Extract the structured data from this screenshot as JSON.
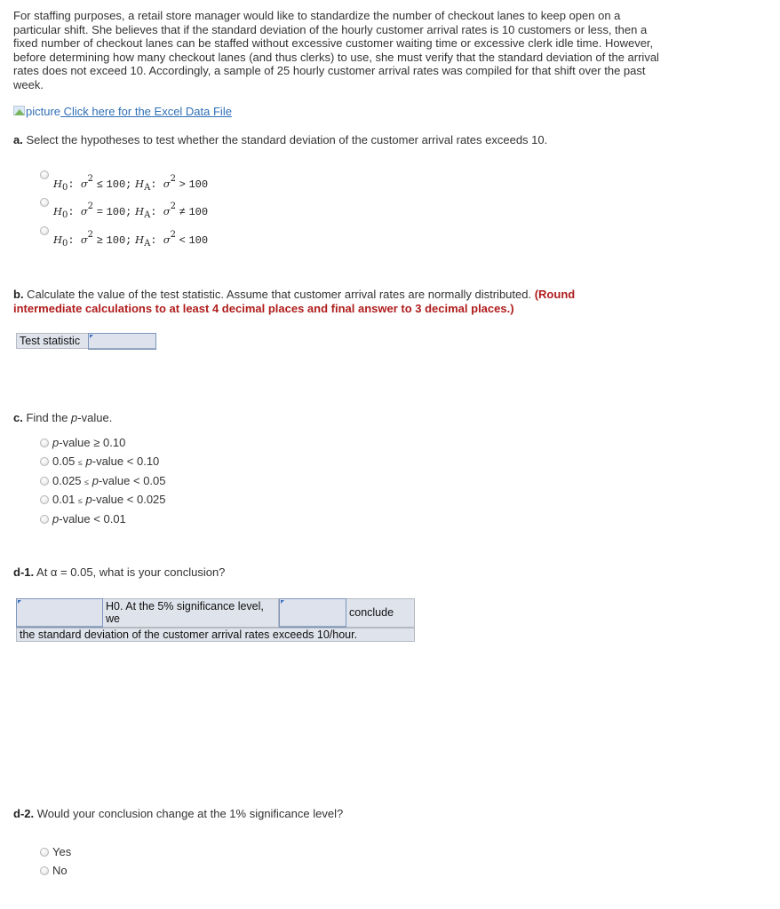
{
  "intro": "For staffing purposes, a retail store manager would like to standardize the number of checkout lanes to keep open on a particular shift. She believes that if the standard deviation of the hourly customer arrival rates is 10 customers or less, then a fixed number of checkout lanes can be staffed without excessive customer waiting time or excessive clerk idle time. However, before determining how many checkout lanes (and thus clerks) to use, she must verify that the standard deviation of the arrival rates does not exceed 10. Accordingly, a sample of 25 hourly customer arrival rates was compiled for that shift over the past week.",
  "data_link": {
    "icon": "broken-image-icon",
    "image_alt": "picture",
    "label": " Click here for the Excel Data File"
  },
  "part_a": {
    "label": "a.",
    "prompt": " Select the hypotheses to test whether the standard deviation of the customer arrival rates exceeds 10.",
    "options": [
      {
        "h0_rel": "≤",
        "h0_val": "100;",
        "ha_rel": ">",
        "ha_val": "100"
      },
      {
        "h0_rel": "=",
        "h0_val": "100;",
        "ha_rel": "≠",
        "ha_val": "100"
      },
      {
        "h0_rel": "≥",
        "h0_val": "100;",
        "ha_rel": "<",
        "ha_val": "100"
      }
    ],
    "h0_label": "H",
    "h0_sub": "0",
    "ha_label": "H",
    "ha_sub": "A",
    "sigma": "σ",
    "sq": "2"
  },
  "part_b": {
    "label": "b.",
    "prompt": " Calculate the value of the test statistic. Assume that customer arrival rates are normally distributed. ",
    "instruction": "(Round intermediate calculations to at least 4 decimal places and final answer to 3 decimal places.)",
    "field_label": "Test statistic",
    "field_value": ""
  },
  "part_c": {
    "label": "c.",
    "prompt_pre": " Find the ",
    "prompt_italic": "p",
    "prompt_post": "-value.",
    "options": [
      {
        "pre": "",
        "mid_rel": "",
        "italic": "p",
        "post": "-value ",
        "rel": "≥",
        "val": " 0.10"
      },
      {
        "pre": "0.05 ",
        "mid_rel": "≤",
        "italic": "p",
        "post": "-value ",
        "rel": "<",
        "val": " 0.10"
      },
      {
        "pre": "0.025 ",
        "mid_rel": "≤",
        "italic": "p",
        "post": "-value ",
        "rel": "<",
        "val": " 0.05"
      },
      {
        "pre": "0.01 ",
        "mid_rel": "≤",
        "italic": "p",
        "post": "-value ",
        "rel": "<",
        "val": " 0.025"
      },
      {
        "pre": "",
        "mid_rel": "",
        "italic": "p",
        "post": "-value ",
        "rel": "<",
        "val": " 0.01"
      }
    ]
  },
  "part_d1": {
    "label": "d-1.",
    "prompt": " At α = 0.05, what is your conclusion?",
    "select1_value": "",
    "text1": "H0. At the 5% significance level, we",
    "select2_value": "",
    "text2": "conclude",
    "text3": "the standard deviation of the customer arrival rates exceeds 10/hour."
  },
  "part_d2": {
    "label": "d-2.",
    "prompt": " Would your conclusion change at the 1% significance level?",
    "options": [
      "Yes",
      "No"
    ]
  }
}
